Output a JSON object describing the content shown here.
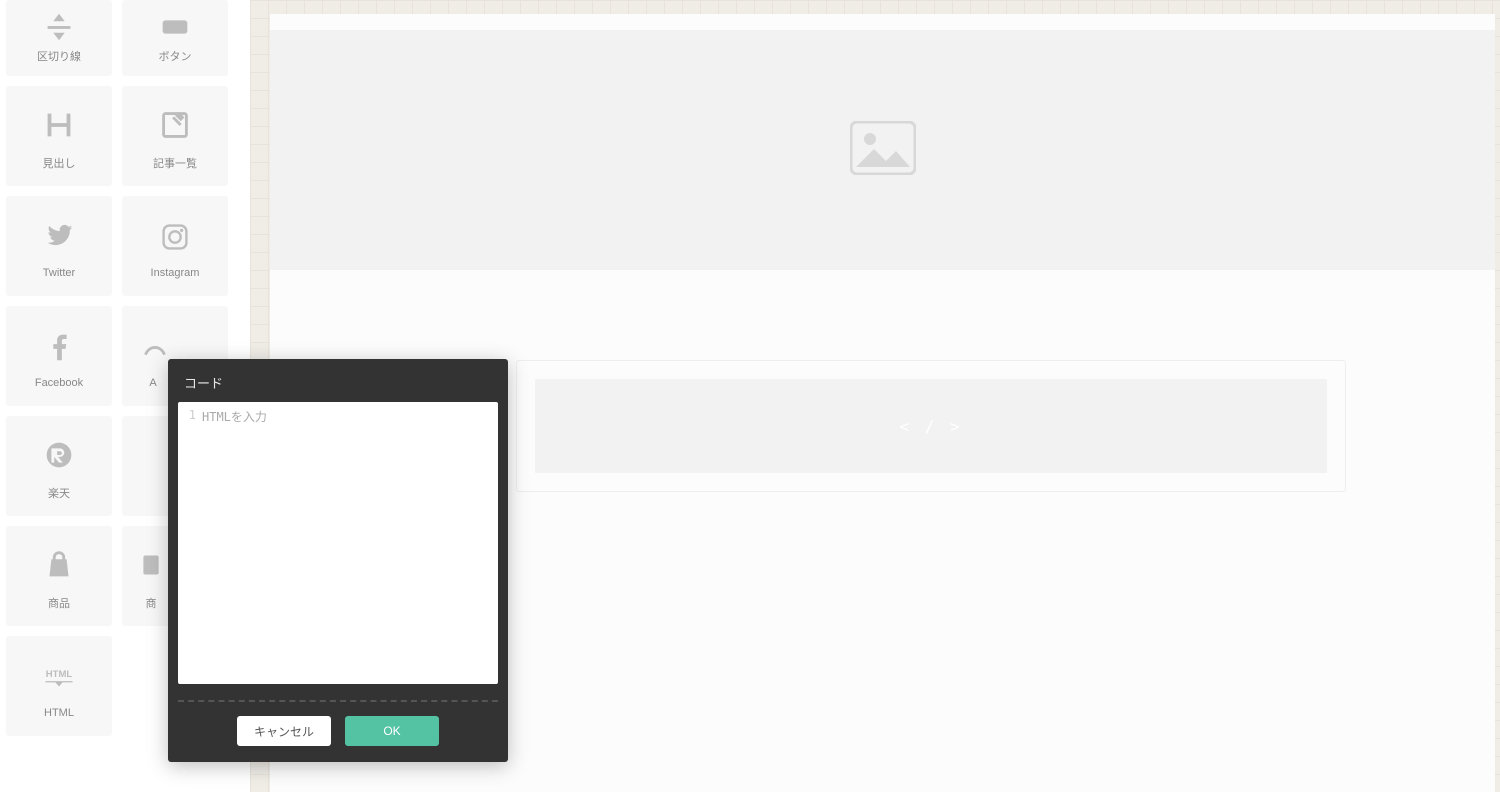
{
  "sidebar": {
    "widgets": [
      {
        "label": "区切り線"
      },
      {
        "label": "ボタン"
      },
      {
        "label": "見出し"
      },
      {
        "label": "記事一覧"
      },
      {
        "label": "Twitter"
      },
      {
        "label": "Instagram"
      },
      {
        "label": "Facebook"
      },
      {
        "label": "A"
      },
      {
        "label": "楽天"
      },
      {
        "label": ""
      },
      {
        "label": "商品"
      },
      {
        "label": "商"
      },
      {
        "label": "HTML"
      }
    ]
  },
  "canvas": {
    "code_placeholder": "< / >"
  },
  "modal": {
    "title": "コード",
    "line_number": "1",
    "placeholder": "HTMLを入力",
    "cancel_label": "キャンセル",
    "ok_label": "OK"
  }
}
